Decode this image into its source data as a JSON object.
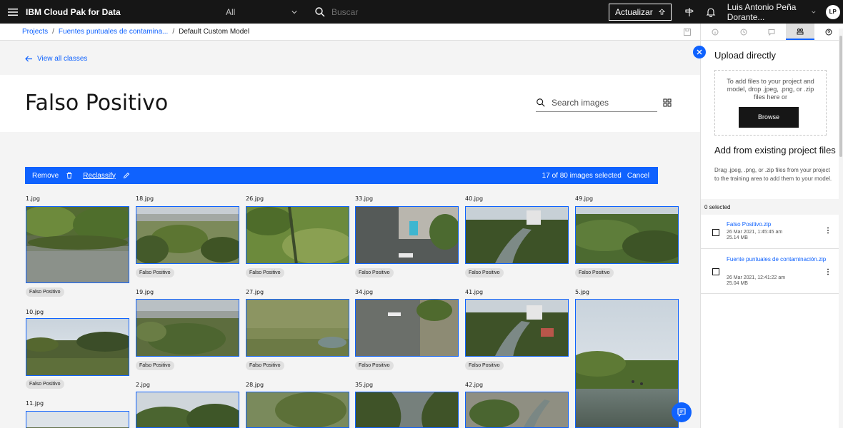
{
  "header": {
    "brand": "IBM Cloud Pak for Data",
    "scope": "All",
    "search_placeholder": "Buscar",
    "update_label": "Actualizar",
    "user_name": "Luis Antonio Peña Dorante...",
    "avatar_initials": "LP"
  },
  "breadcrumb": {
    "projects": "Projects",
    "project": "Fuentes puntuales de contamina...",
    "current": "Default Custom Model",
    "separator": "/"
  },
  "page": {
    "back_label": "View all classes",
    "title": "Falso Positivo",
    "search_placeholder": "Search images"
  },
  "action_bar": {
    "remove": "Remove",
    "reclassify": "Reclassify",
    "selection": "17 of 80 images selected",
    "cancel": "Cancel"
  },
  "images": [
    {
      "name": "1.jpg",
      "tag": "Falso Positivo"
    },
    {
      "name": "18.jpg",
      "tag": "Falso Positivo"
    },
    {
      "name": "26.jpg",
      "tag": "Falso Positivo"
    },
    {
      "name": "33.jpg",
      "tag": "Falso Positivo"
    },
    {
      "name": "40.jpg",
      "tag": "Falso Positivo"
    },
    {
      "name": "49.jpg",
      "tag": "Falso Positivo"
    },
    {
      "name": "10.jpg",
      "tag": "Falso Positivo"
    },
    {
      "name": "19.jpg",
      "tag": "Falso Positivo"
    },
    {
      "name": "27.jpg",
      "tag": "Falso Positivo"
    },
    {
      "name": "34.jpg",
      "tag": "Falso Positivo"
    },
    {
      "name": "41.jpg",
      "tag": "Falso Positivo"
    },
    {
      "name": "5.jpg",
      "tag": ""
    },
    {
      "name": "11.jpg",
      "tag": ""
    },
    {
      "name": "2.jpg",
      "tag": ""
    },
    {
      "name": "28.jpg",
      "tag": ""
    },
    {
      "name": "35.jpg",
      "tag": ""
    },
    {
      "name": "42.jpg",
      "tag": ""
    }
  ],
  "panel": {
    "upload_title": "Upload directly",
    "drop_text": "To add files to your project and model, drop .jpeg, .png, or .zip files here or",
    "browse": "Browse",
    "existing_title": "Add from existing project files",
    "existing_desc": "Drag .jpeg, .png, or .zip files from your project to the training area to add them to your model.",
    "selected_count": "0 selected",
    "files": [
      {
        "name": "Falso Positivo.zip",
        "date": "26 Mar 2021, 1:45:45 am",
        "size": "25.14 MB"
      },
      {
        "name": "Fuente puntuales de contaminación.zip",
        "date": "26 Mar 2021, 12:41:22 am",
        "size": "25.04 MB"
      }
    ]
  },
  "colors": {
    "accent": "#0f62fe",
    "topbar": "#161616",
    "tag_bg": "#e0e0e0"
  }
}
